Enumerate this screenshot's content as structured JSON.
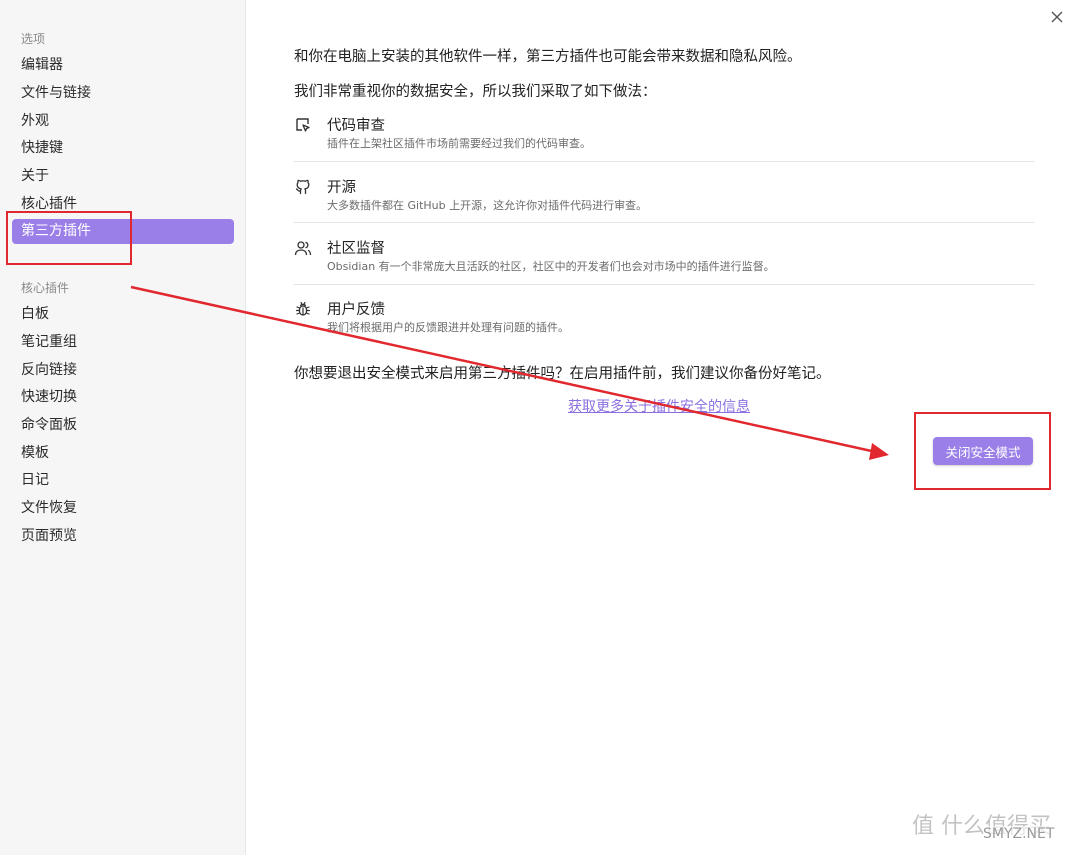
{
  "sidebar": {
    "options_heading": "选项",
    "options_items": [
      {
        "label": "编辑器"
      },
      {
        "label": "文件与链接"
      },
      {
        "label": "外观"
      },
      {
        "label": "快捷键"
      },
      {
        "label": "关于"
      },
      {
        "label": "核心插件"
      },
      {
        "label": "第三方插件",
        "active": true
      }
    ],
    "core_heading": "核心插件",
    "core_items": [
      {
        "label": "白板"
      },
      {
        "label": "笔记重组"
      },
      {
        "label": "反向链接"
      },
      {
        "label": "快速切换"
      },
      {
        "label": "命令面板"
      },
      {
        "label": "模板"
      },
      {
        "label": "日记"
      },
      {
        "label": "文件恢复"
      },
      {
        "label": "页面预览"
      }
    ]
  },
  "main": {
    "intro_line1": "和你在电脑上安装的其他软件一样，第三方插件也可能会带来数据和隐私风险。",
    "intro_line2": "我们非常重视你的数据安全，所以我们采取了如下做法：",
    "features": [
      {
        "icon": "code-review-icon",
        "title": "代码审查",
        "desc": "插件在上架社区插件市场前需要经过我们的代码审查。"
      },
      {
        "icon": "github-icon",
        "title": "开源",
        "desc": "大多数插件都在 GitHub 上开源，这允许你对插件代码进行审查。"
      },
      {
        "icon": "users-icon",
        "title": "社区监督",
        "desc": "Obsidian 有一个非常庞大且活跃的社区，社区中的开发者们也会对市场中的插件进行监督。"
      },
      {
        "icon": "bug-icon",
        "title": "用户反馈",
        "desc": "我们将根据用户的反馈跟进并处理有问题的插件。"
      }
    ],
    "question": "你想要退出安全模式来启用第三方插件吗？在启用插件前，我们建议你备份好笔记。",
    "learn_more_link": "获取更多关于插件安全的信息",
    "disable_safe_mode_button": "关闭安全模式"
  },
  "colors": {
    "accent": "#9b7fe8",
    "annotation": "#e0282e"
  },
  "watermark": {
    "text": "值 什么值得买",
    "site": "SMYZ.NET"
  }
}
